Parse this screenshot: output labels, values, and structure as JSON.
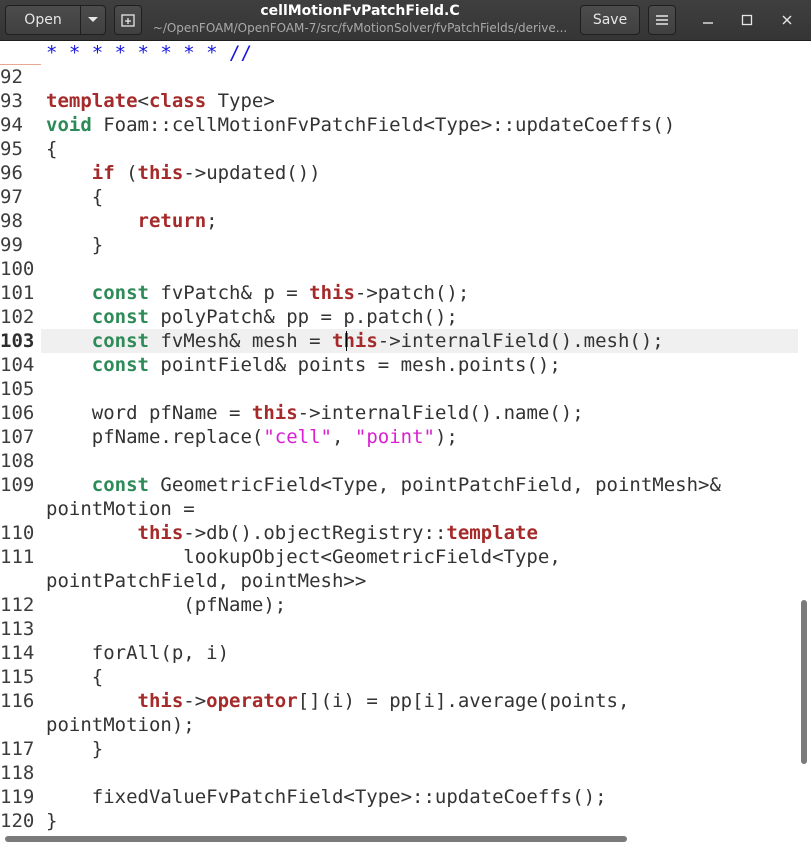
{
  "header": {
    "open_label": "Open",
    "save_label": "Save",
    "title": "cellMotionFvPatchField.C",
    "subtitle": "~/OpenFOAM/OpenFOAM-7/src/fvMotionSolver/fvPatchFields/derive...",
    "icons": {
      "open_menu": "chevron-down-icon",
      "new_tab": "new-tab-icon",
      "menu": "hamburger-menu-icon",
      "minimize": "minimize-icon",
      "maximize": "maximize-icon",
      "close": "close-icon"
    }
  },
  "editor": {
    "current_line": "103",
    "colors": {
      "keyword": "#a52a2a",
      "type": "#2e8b57",
      "string": "#da1fd0",
      "comment": "#1515e0",
      "current_line_bg": "#f0f0f0"
    },
    "lines": [
      {
        "n": "",
        "segs": [
          {
            "t": "* * * * * * * * //",
            "c": "cmt"
          }
        ]
      },
      {
        "n": "92",
        "segs": []
      },
      {
        "n": "93",
        "segs": [
          {
            "t": "template",
            "c": "kw"
          },
          {
            "t": "<"
          },
          {
            "t": "class",
            "c": "kw"
          },
          {
            "t": " Type>"
          }
        ]
      },
      {
        "n": "94",
        "segs": [
          {
            "t": "void",
            "c": "ty"
          },
          {
            "t": " Foam::cellMotionFvPatchField<Type>::updateCoeffs()"
          }
        ]
      },
      {
        "n": "95",
        "segs": [
          {
            "t": "{"
          }
        ]
      },
      {
        "n": "96",
        "segs": [
          {
            "t": "    "
          },
          {
            "t": "if",
            "c": "kw"
          },
          {
            "t": " ("
          },
          {
            "t": "this",
            "c": "kw"
          },
          {
            "t": "->updated())"
          }
        ]
      },
      {
        "n": "97",
        "segs": [
          {
            "t": "    {"
          }
        ]
      },
      {
        "n": "98",
        "segs": [
          {
            "t": "        "
          },
          {
            "t": "return",
            "c": "kw"
          },
          {
            "t": ";"
          }
        ]
      },
      {
        "n": "99",
        "segs": [
          {
            "t": "    }"
          }
        ]
      },
      {
        "n": "100",
        "segs": []
      },
      {
        "n": "101",
        "segs": [
          {
            "t": "    "
          },
          {
            "t": "const",
            "c": "ty"
          },
          {
            "t": " fvPatch& p = "
          },
          {
            "t": "this",
            "c": "kw"
          },
          {
            "t": "->patch();"
          }
        ]
      },
      {
        "n": "102",
        "segs": [
          {
            "t": "    "
          },
          {
            "t": "const",
            "c": "ty"
          },
          {
            "t": " polyPatch& pp = p.patch();"
          }
        ]
      },
      {
        "n": "103",
        "segs": [
          {
            "t": "    "
          },
          {
            "t": "const",
            "c": "ty"
          },
          {
            "t": " fvMesh& mesh = "
          },
          {
            "t": "this",
            "c": "kw"
          },
          {
            "t": "->internalField().mesh();"
          }
        ]
      },
      {
        "n": "104",
        "segs": [
          {
            "t": "    "
          },
          {
            "t": "const",
            "c": "ty"
          },
          {
            "t": " pointField& points = mesh.points();"
          }
        ]
      },
      {
        "n": "105",
        "segs": []
      },
      {
        "n": "106",
        "segs": [
          {
            "t": "    word pfName = "
          },
          {
            "t": "this",
            "c": "kw"
          },
          {
            "t": "->internalField().name();"
          }
        ]
      },
      {
        "n": "107",
        "segs": [
          {
            "t": "    pfName.replace("
          },
          {
            "t": "\"cell\"",
            "c": "str"
          },
          {
            "t": ", "
          },
          {
            "t": "\"point\"",
            "c": "str"
          },
          {
            "t": ");"
          }
        ]
      },
      {
        "n": "108",
        "segs": []
      },
      {
        "n": "109",
        "segs": [
          {
            "t": "    "
          },
          {
            "t": "const",
            "c": "ty"
          },
          {
            "t": " GeometricField<Type, pointPatchField, pointMesh>&"
          }
        ]
      },
      {
        "n": "",
        "segs": [
          {
            "t": "pointMotion ="
          }
        ]
      },
      {
        "n": "110",
        "segs": [
          {
            "t": "        "
          },
          {
            "t": "this",
            "c": "kw"
          },
          {
            "t": "->db().objectRegistry::"
          },
          {
            "t": "template",
            "c": "kw"
          }
        ]
      },
      {
        "n": "111",
        "segs": [
          {
            "t": "            lookupObject<GeometricField<Type,"
          }
        ]
      },
      {
        "n": "",
        "segs": [
          {
            "t": "pointPatchField, pointMesh>>"
          }
        ]
      },
      {
        "n": "112",
        "segs": [
          {
            "t": "            (pfName);"
          }
        ]
      },
      {
        "n": "113",
        "segs": []
      },
      {
        "n": "114",
        "segs": [
          {
            "t": "    forAll(p, i)"
          }
        ]
      },
      {
        "n": "115",
        "segs": [
          {
            "t": "    {"
          }
        ]
      },
      {
        "n": "116",
        "segs": [
          {
            "t": "        "
          },
          {
            "t": "this",
            "c": "kw"
          },
          {
            "t": "->"
          },
          {
            "t": "operator",
            "c": "kw"
          },
          {
            "t": "[](i) = pp[i].average(points,"
          }
        ]
      },
      {
        "n": "",
        "segs": [
          {
            "t": "pointMotion);"
          }
        ]
      },
      {
        "n": "117",
        "segs": [
          {
            "t": "    }"
          }
        ]
      },
      {
        "n": "118",
        "segs": []
      },
      {
        "n": "119",
        "segs": [
          {
            "t": "    fixedValueFvPatchField<Type>::updateCoeffs();"
          }
        ]
      },
      {
        "n": "120",
        "segs": [
          {
            "t": "}"
          }
        ]
      }
    ]
  }
}
